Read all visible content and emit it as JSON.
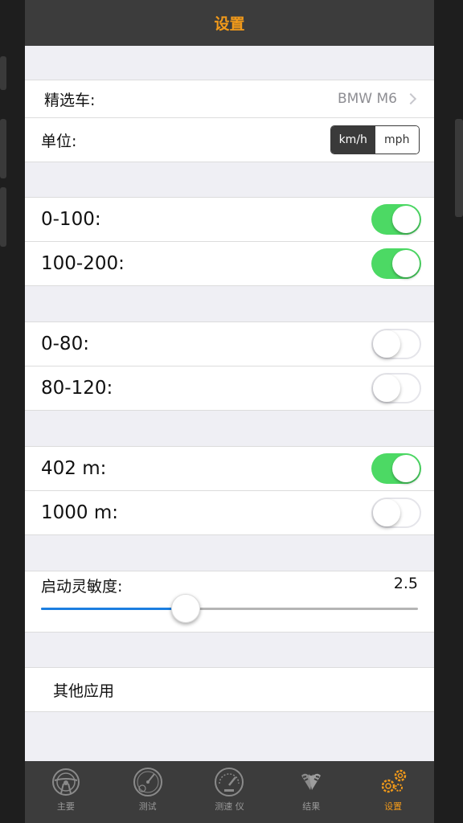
{
  "navbar": {
    "title": "设置"
  },
  "car": {
    "label": "精选车:",
    "value": "BMW M6"
  },
  "units": {
    "label": "单位:",
    "options": [
      "km/h",
      "mph"
    ],
    "selected": "km/h"
  },
  "toggles": [
    {
      "label": "0-100:",
      "on": true
    },
    {
      "label": "100-200:",
      "on": true
    },
    {
      "label": "0-80:",
      "on": false
    },
    {
      "label": "80-120:",
      "on": false
    },
    {
      "label": "402 m:",
      "on": true
    },
    {
      "label": "1000 m:",
      "on": false
    }
  ],
  "sensitivity": {
    "label": "启动灵敏度:",
    "value": "2.5",
    "fraction": 0.384
  },
  "other_apps": {
    "label": "其他应用"
  },
  "tabs": [
    {
      "label": "主要",
      "icon": "steering-wheel-icon"
    },
    {
      "label": "测试",
      "icon": "speedometer-icon"
    },
    {
      "label": "测速 仪",
      "icon": "gauge-icon"
    },
    {
      "label": "结果",
      "icon": "racing-flags-icon"
    },
    {
      "label": "设置",
      "icon": "gears-icon"
    }
  ],
  "colors": {
    "accent": "#f29a1a",
    "toggle_on": "#4cd964",
    "slider": "#1b7ee0"
  }
}
